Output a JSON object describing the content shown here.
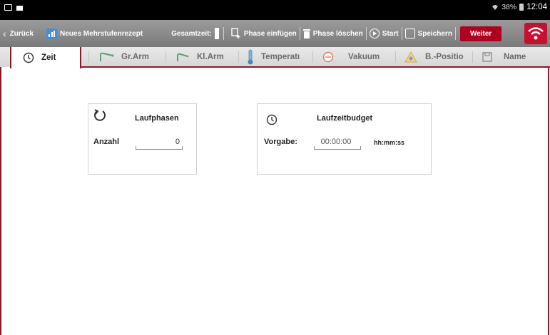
{
  "statusbar": {
    "battery": "38%",
    "time": "12:04"
  },
  "toolbar": {
    "back_label": "Zurück",
    "recipe_label": "Neues Mehrstufenrezept",
    "gesamtzeit_label": "Gesamtzeit:",
    "insert_phase_label": "Phase einfügen",
    "delete_phase_label": "Phase löschen",
    "start_label": "Start",
    "save_label": "Speichern",
    "next_label": "Weiter"
  },
  "tabs": [
    {
      "label": "Zeit",
      "icon": "clock-icon",
      "active": true
    },
    {
      "label": "Gr.Arm",
      "icon": "large-arm-icon",
      "active": false
    },
    {
      "label": "Kl.Arm",
      "icon": "small-arm-icon",
      "active": false
    },
    {
      "label": "Temperatı",
      "icon": "thermometer-icon",
      "active": false
    },
    {
      "label": "Vakuum",
      "icon": "vacuum-icon",
      "active": false
    },
    {
      "label": "B.-Positio",
      "icon": "position-icon",
      "active": false
    },
    {
      "label": "Name",
      "icon": "save-icon",
      "active": false
    }
  ],
  "laufphasen": {
    "title": "Laufphasen",
    "count_label": "Anzahl",
    "count_value": "0"
  },
  "laufzeitbudget": {
    "title": "Laufzeitbudget",
    "vorgabe_label": "Vorgabe:",
    "vorgabe_value": "00:00:00",
    "unit": "hh:mm:ss"
  },
  "colors": {
    "accent": "#8a1a26",
    "toolbar": "#8a8a8a",
    "weiter": "#b00020",
    "wifi": "#c8102e"
  }
}
